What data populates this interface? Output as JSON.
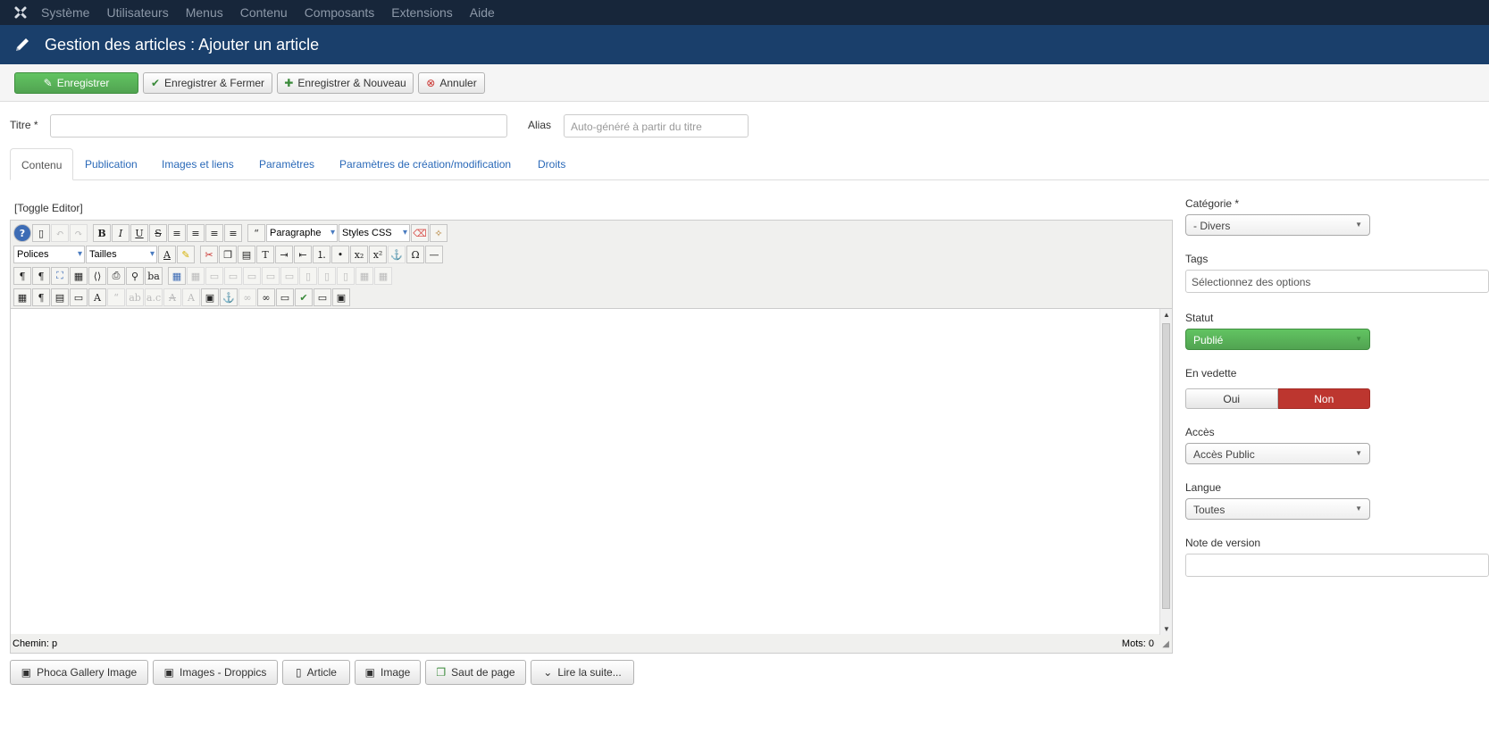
{
  "topnav": {
    "items": [
      "Système",
      "Utilisateurs",
      "Menus",
      "Contenu",
      "Composants",
      "Extensions",
      "Aide"
    ]
  },
  "header": {
    "title": "Gestion des articles : Ajouter un article"
  },
  "toolbar": {
    "save": "Enregistrer",
    "save_close": "Enregistrer & Fermer",
    "save_new": "Enregistrer & Nouveau",
    "cancel": "Annuler"
  },
  "form": {
    "title_label": "Titre *",
    "title_value": "",
    "alias_label": "Alias",
    "alias_placeholder": "Auto-généré à partir du titre"
  },
  "tabs": [
    "Contenu",
    "Publication",
    "Images et liens",
    "Paramètres",
    "Paramètres de création/modification",
    "Droits"
  ],
  "editor": {
    "toggle": "[Toggle Editor]",
    "format_select": "Paragraphe",
    "styles_select": "Styles CSS",
    "fonts_select": "Polices",
    "sizes_select": "Tailles",
    "path": "Chemin: p",
    "word_count": "Mots: 0"
  },
  "bottom_buttons": [
    "Phoca Gallery Image",
    "Images - Droppics",
    "Article",
    "Image",
    "Saut de page",
    "Lire la suite..."
  ],
  "sidebar": {
    "category_label": "Catégorie *",
    "category_value": "- Divers",
    "tags_label": "Tags",
    "tags_placeholder": "Sélectionnez des options",
    "status_label": "Statut",
    "status_value": "Publié",
    "featured_label": "En vedette",
    "featured_yes": "Oui",
    "featured_no": "Non",
    "access_label": "Accès",
    "access_value": "Accès Public",
    "language_label": "Langue",
    "language_value": "Toutes",
    "version_note_label": "Note de version"
  }
}
